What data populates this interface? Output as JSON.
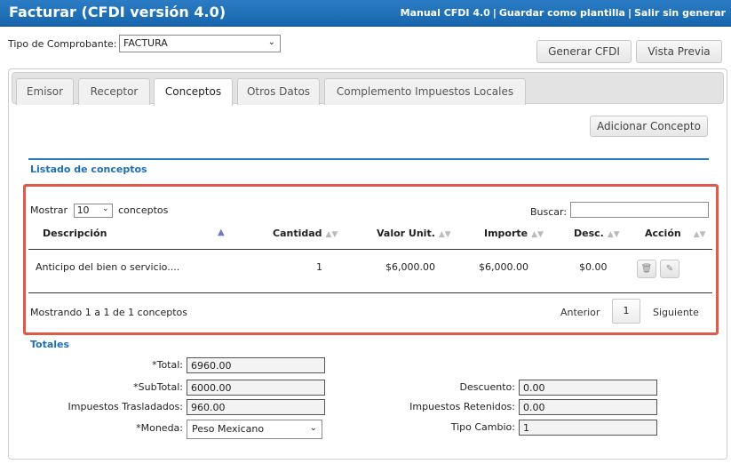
{
  "header": {
    "title": "Facturar (CFDI versión 4.0)",
    "links": [
      "Manual CFDI 4.0",
      "Guardar como plantilla",
      "Salir sin generar"
    ],
    "separator": "|"
  },
  "tipo_comprobante": {
    "label": "Tipo de Comprobante:",
    "value": "FACTURA"
  },
  "actions": {
    "generar": "Generar CFDI",
    "vista_previa": "Vista Previa"
  },
  "tabs": [
    {
      "label": "Emisor"
    },
    {
      "label": "Receptor"
    },
    {
      "label": "Conceptos"
    },
    {
      "label": "Otros Datos"
    },
    {
      "label": "Complemento Impuestos Locales"
    }
  ],
  "conceptos": {
    "adicionar": "Adicionar Concepto",
    "section_title": "Listado de conceptos",
    "mostrar_prefix": "Mostrar",
    "mostrar_value": "10",
    "mostrar_suffix": "conceptos",
    "buscar_label": "Buscar:",
    "columns": [
      "Descripción",
      "Cantidad",
      "Valor Unit.",
      "Importe",
      "Desc.",
      "Acción"
    ],
    "rows": [
      {
        "descripcion": "Anticipo del bien o servicio....",
        "cantidad": "1",
        "valor_unit": "$6,000.00",
        "importe": "$6,000.00",
        "desc": "$0.00"
      }
    ],
    "info": "Mostrando 1 a 1 de 1 conceptos",
    "pagination": {
      "prev": "Anterior",
      "page": "1",
      "next": "Siguiente"
    }
  },
  "totales": {
    "title": "Totales",
    "total_label": "*Total:",
    "total_value": "6960.00",
    "subtotal_label": "*SubTotal:",
    "subtotal_value": "6000.00",
    "trasladados_label": "Impuestos Trasladados:",
    "trasladados_value": "960.00",
    "moneda_label": "*Moneda:",
    "moneda_value": "Peso Mexicano",
    "descuento_label": "Descuento:",
    "descuento_value": "0.00",
    "retenidos_label": "Impuestos Retenidos:",
    "retenidos_value": "0.00",
    "tipo_cambio_label": "Tipo Cambio:",
    "tipo_cambio_value": "1"
  },
  "colors": {
    "header_bg": "#1766ad",
    "accent": "#1f6fb2",
    "highlight_border": "#e05a4a"
  },
  "icons": {
    "delete": "trash-icon",
    "edit": "pencil-icon",
    "sort": "sort-arrows-icon",
    "dropdown": "chevron-down-icon"
  }
}
